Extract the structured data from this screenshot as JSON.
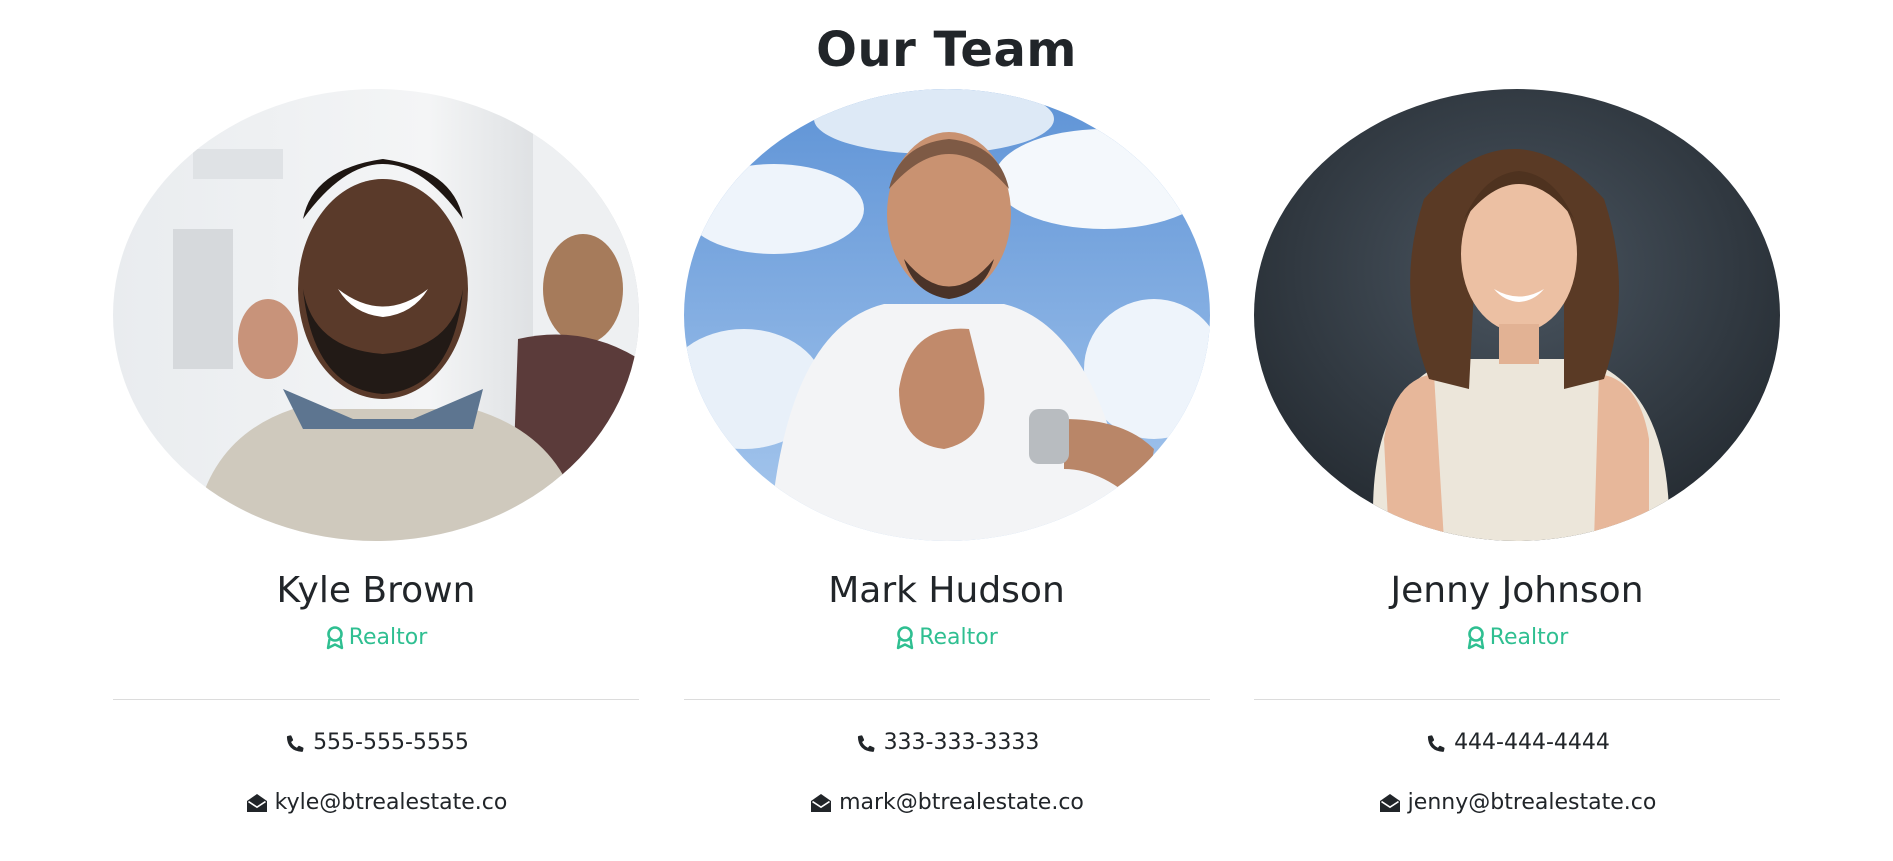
{
  "section": {
    "title": "Our Team"
  },
  "colors": {
    "accent": "#2fbf91",
    "text": "#212529",
    "divider": "#dcdcdc"
  },
  "members": [
    {
      "name": "Kyle Brown",
      "role": "Realtor",
      "role_icon": "award-ribbon-icon",
      "phone": "555-555-5555",
      "phone_icon": "phone-icon",
      "email": "kyle@btrealestate.co",
      "email_icon": "envelope-open-icon"
    },
    {
      "name": "Mark Hudson",
      "role": "Realtor",
      "role_icon": "award-ribbon-icon",
      "phone": "333-333-3333",
      "phone_icon": "phone-icon",
      "email": "mark@btrealestate.co",
      "email_icon": "envelope-open-icon"
    },
    {
      "name": "Jenny Johnson",
      "role": "Realtor",
      "role_icon": "award-ribbon-icon",
      "phone": "444-444-4444",
      "phone_icon": "phone-icon",
      "email": "jenny@btrealestate.co",
      "email_icon": "envelope-open-icon"
    }
  ]
}
